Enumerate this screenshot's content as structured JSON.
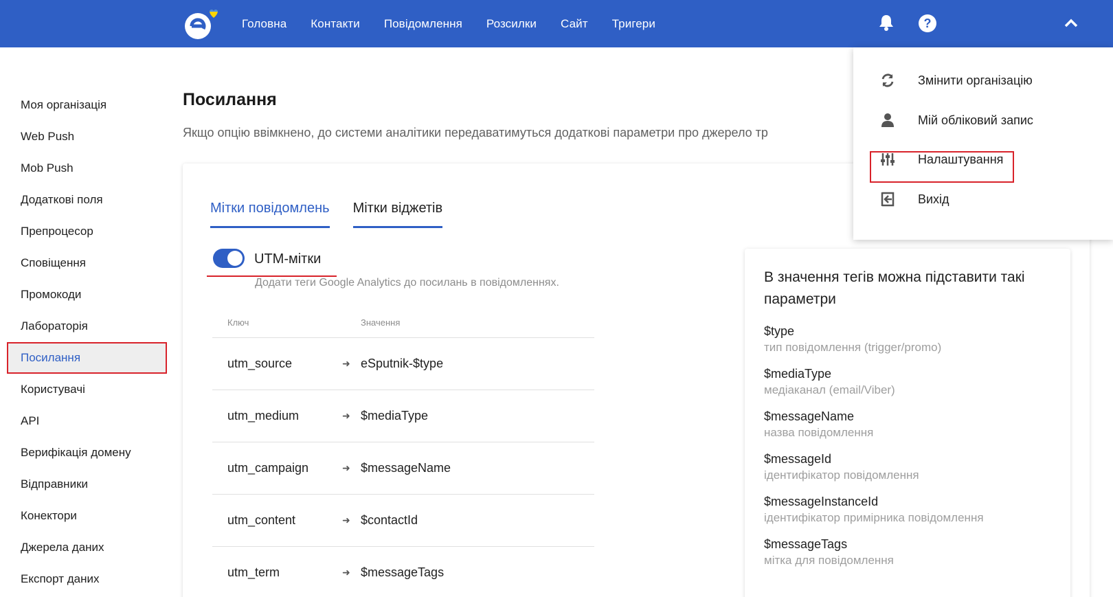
{
  "nav": {
    "items": [
      "Головна",
      "Контакти",
      "Повідомлення",
      "Розсилки",
      "Сайт",
      "Тригери"
    ]
  },
  "sidebar": {
    "items": [
      "Моя організація",
      "Web Push",
      "Mob Push",
      "Додаткові поля",
      "Препроцесор",
      "Сповіщення",
      "Промокоди",
      "Лабораторія",
      "Посилання",
      "Користувачі",
      "API",
      "Верифікація домену",
      "Відправники",
      "Конектори",
      "Джерела даних",
      "Експорт даних"
    ],
    "active": "Посилання"
  },
  "page": {
    "title": "Посилання",
    "description": "Якщо опцію ввімкнено, до системи аналітики передаватимуться додаткові параметри про джерело тр"
  },
  "tabs": [
    "Мітки повідомлень",
    "Мітки віджетів"
  ],
  "utm": {
    "label": "UTM-мітки",
    "enabled": true,
    "hint": "Додати теги Google Analytics до посилань в повідомленнях."
  },
  "table": {
    "headers": [
      "Ключ",
      "Значення"
    ],
    "rows": [
      {
        "key": "utm_source",
        "value": "eSputnik-$type"
      },
      {
        "key": "utm_medium",
        "value": "$mediaType"
      },
      {
        "key": "utm_campaign",
        "value": "$messageName"
      },
      {
        "key": "utm_content",
        "value": "$contactId"
      },
      {
        "key": "utm_term",
        "value": "$messageTags"
      }
    ]
  },
  "params": {
    "title": "В значення тегів можна підставити такі параметри",
    "items": [
      {
        "name": "$type",
        "desc": "тип повідомлення (trigger/promo)"
      },
      {
        "name": "$mediaType",
        "desc": "медіаканал (email/Viber)"
      },
      {
        "name": "$messageName",
        "desc": "назва повідомлення"
      },
      {
        "name": "$messageId",
        "desc": "ідентифікатор повідомлення"
      },
      {
        "name": "$messageInstanceId",
        "desc": "ідентифікатор примірника повідомлення"
      },
      {
        "name": "$messageTags",
        "desc": "мітка для повідомлення"
      }
    ]
  },
  "dropdown": {
    "items": [
      {
        "label": "Змінити організацію",
        "icon": "sync-icon"
      },
      {
        "label": "Мій обліковий запис",
        "icon": "user-icon"
      },
      {
        "label": "Налаштування",
        "icon": "settings-sliders-icon"
      },
      {
        "label": "Вихід",
        "icon": "logout-icon"
      }
    ]
  },
  "colors": {
    "brand": "#2f5fc5",
    "highlight": "#d8222a"
  }
}
